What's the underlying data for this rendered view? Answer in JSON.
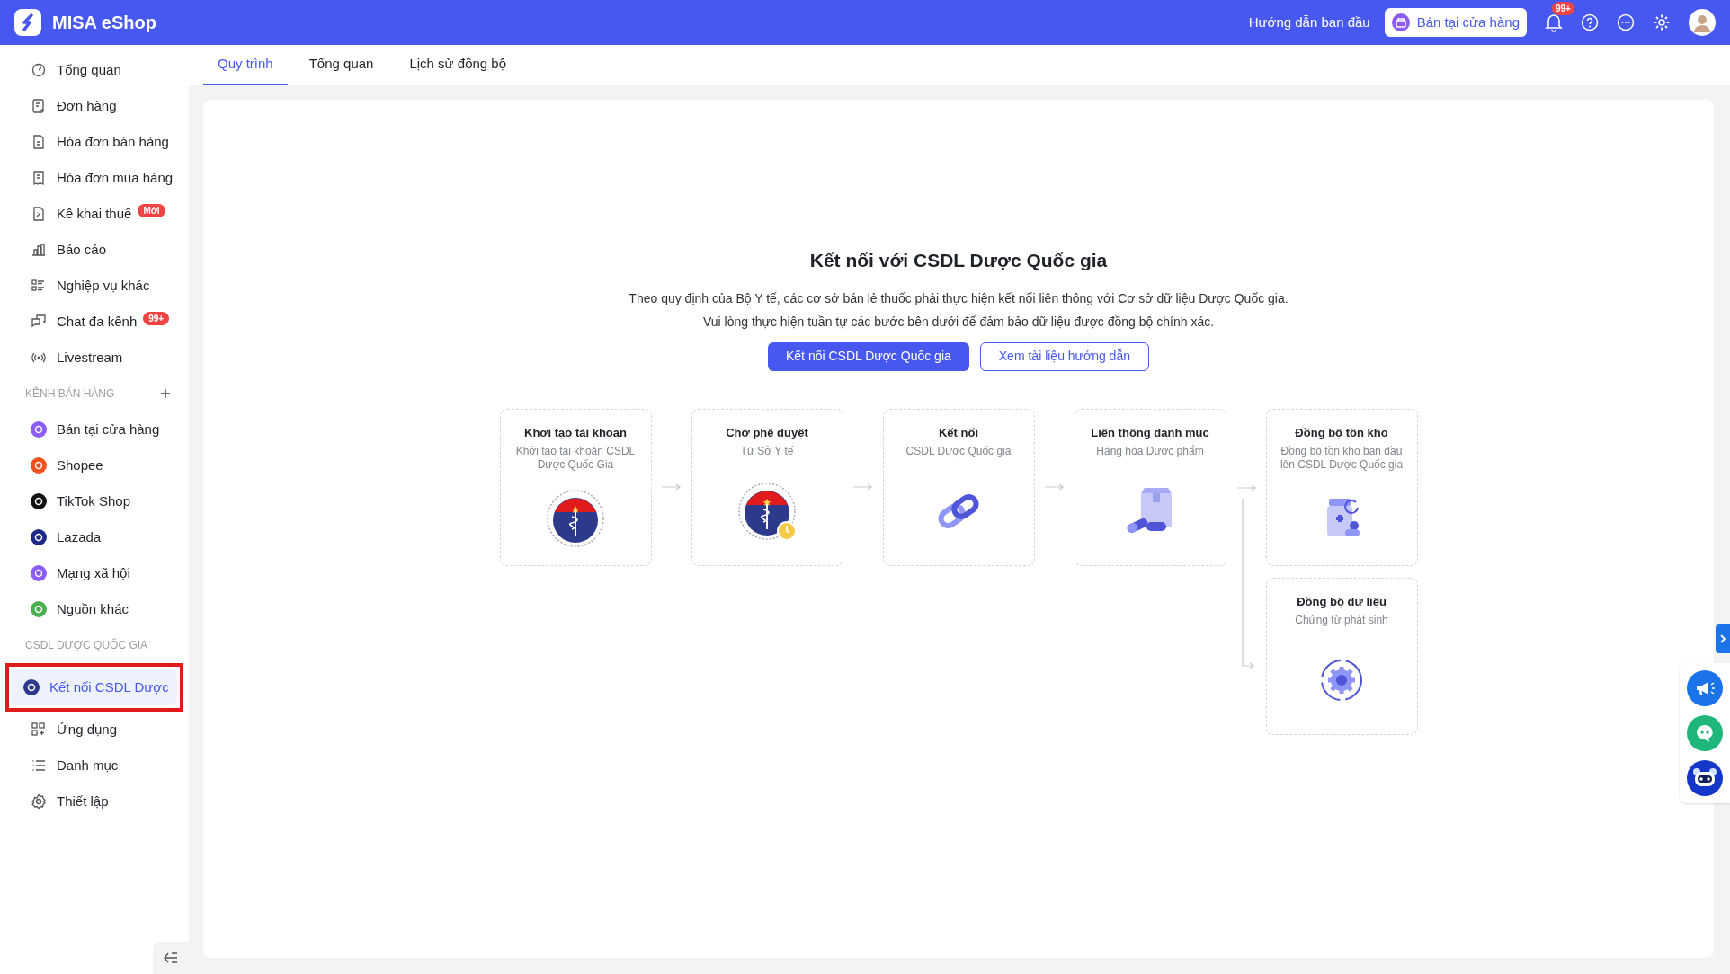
{
  "app": {
    "name": "MISA eShop"
  },
  "topbar": {
    "guide_link": "Hướng dẫn ban đầu",
    "store_button": "Bán tại cửa hàng",
    "notification_badge": "99+"
  },
  "sidebar": {
    "items": [
      {
        "kind": "nav",
        "label": "Tổng quan",
        "selected": false
      },
      {
        "kind": "nav",
        "label": "Đơn hàng",
        "selected": false
      },
      {
        "kind": "nav",
        "label": "Hóa đơn bán hàng",
        "selected": false
      },
      {
        "kind": "nav",
        "label": "Hóa đơn mua hàng",
        "selected": false
      },
      {
        "kind": "nav",
        "label": "Kê khai thuế",
        "badge": "Mới",
        "selected": false
      },
      {
        "kind": "nav",
        "label": "Báo cáo",
        "selected": false
      },
      {
        "kind": "nav",
        "label": "Nghiệp vụ khác",
        "selected": false
      },
      {
        "kind": "nav",
        "label": "Chat đa kênh",
        "badge": "99+",
        "selected": false
      },
      {
        "kind": "nav",
        "label": "Livestream",
        "selected": false
      },
      {
        "kind": "section",
        "label": "KÊNH BÁN HÀNG"
      },
      {
        "kind": "channel",
        "color": "#8b5cf6",
        "label": "Bán tại cửa hàng",
        "selected": false
      },
      {
        "kind": "channel",
        "color": "#f4511e",
        "label": "Shopee",
        "selected": false
      },
      {
        "kind": "channel",
        "color": "#111111",
        "label": "TikTok Shop",
        "selected": false
      },
      {
        "kind": "channel",
        "color": "#1e2a8a",
        "label": "Lazada",
        "selected": false
      },
      {
        "kind": "channel",
        "color": "#8b5cf6",
        "label": "Mạng xã hội",
        "selected": false
      },
      {
        "kind": "channel",
        "color": "#4caf50",
        "label": "Nguồn khác",
        "selected": false
      },
      {
        "kind": "section",
        "label": "CSDL DƯỢC QUỐC GIA"
      },
      {
        "kind": "channel",
        "color": "#2d3a8c",
        "label": "Kết nối CSDL Dược",
        "selected": true
      },
      {
        "kind": "nav",
        "label": "Ứng dụng",
        "selected": false
      },
      {
        "kind": "nav",
        "label": "Danh mục",
        "selected": false
      },
      {
        "kind": "nav",
        "label": "Thiết lập",
        "selected": false
      }
    ]
  },
  "tabs": [
    {
      "label": "Quy trình",
      "selected": true
    },
    {
      "label": "Tổng quan",
      "selected": false
    },
    {
      "label": "Lịch sử đồng bộ",
      "selected": false
    }
  ],
  "content": {
    "title": "Kết nối với CSDL Dược Quốc gia",
    "description": [
      "Theo quy định của Bộ Y tế, các cơ sở bán lẻ thuốc phải thực hiện kết nối liên thông với Cơ sở dữ liệu Dược Quốc gia.",
      "Vui lòng thực hiện tuần tự các bước bên dưới để đảm bảo dữ liệu được đồng bộ chính xác."
    ],
    "primary_button": "Kết nối CSDL Dược Quốc gia",
    "secondary_button": "Xem tài liệu hướng dẫn",
    "steps": [
      {
        "kind": "emblem",
        "title": "Khởi tạo tài khoản",
        "subtitle": "Khởi tạo tài khoản CSDL Dược Quốc Gia"
      },
      {
        "kind": "emblem-pending",
        "title": "Chờ phê duyệt",
        "subtitle": "Từ Sở Y tế"
      },
      {
        "kind": "link",
        "title": "Kết nối",
        "subtitle": "CSDL Dược Quốc gia"
      },
      {
        "kind": "box",
        "title": "Liên thông danh mục",
        "subtitle": "Hàng hóa Dược phẩm"
      }
    ],
    "final_steps": [
      {
        "kind": "stock",
        "title": "Đồng bộ tồn kho",
        "subtitle": "Đồng bộ tồn kho ban đầu lên CSDL Dược Quốc gia"
      },
      {
        "kind": "sync",
        "title": "Đồng bộ dữ liệu",
        "subtitle": "Chứng từ phát sinh"
      }
    ]
  }
}
